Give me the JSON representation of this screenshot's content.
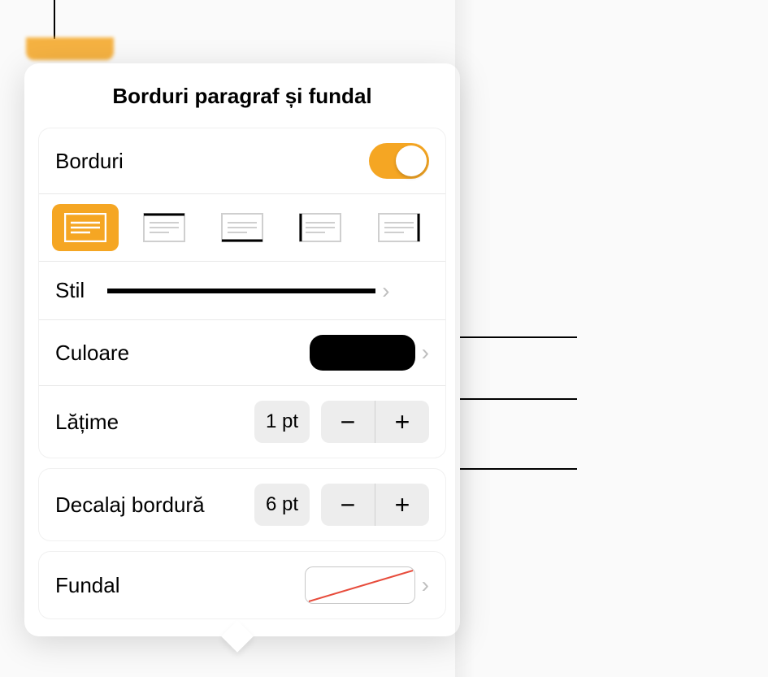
{
  "panel": {
    "title": "Borduri paragraf și fundal"
  },
  "borders": {
    "label": "Borduri",
    "enabled": true
  },
  "style": {
    "label": "Stil"
  },
  "color": {
    "label": "Culoare",
    "value_hex": "#000000"
  },
  "width": {
    "label": "Lățime",
    "value": "1 pt"
  },
  "offset": {
    "label": "Decalaj bordură",
    "value": "6 pt"
  },
  "background": {
    "label": "Fundal"
  },
  "under_row": {
    "label": "Borduri paragraf și fundal"
  }
}
